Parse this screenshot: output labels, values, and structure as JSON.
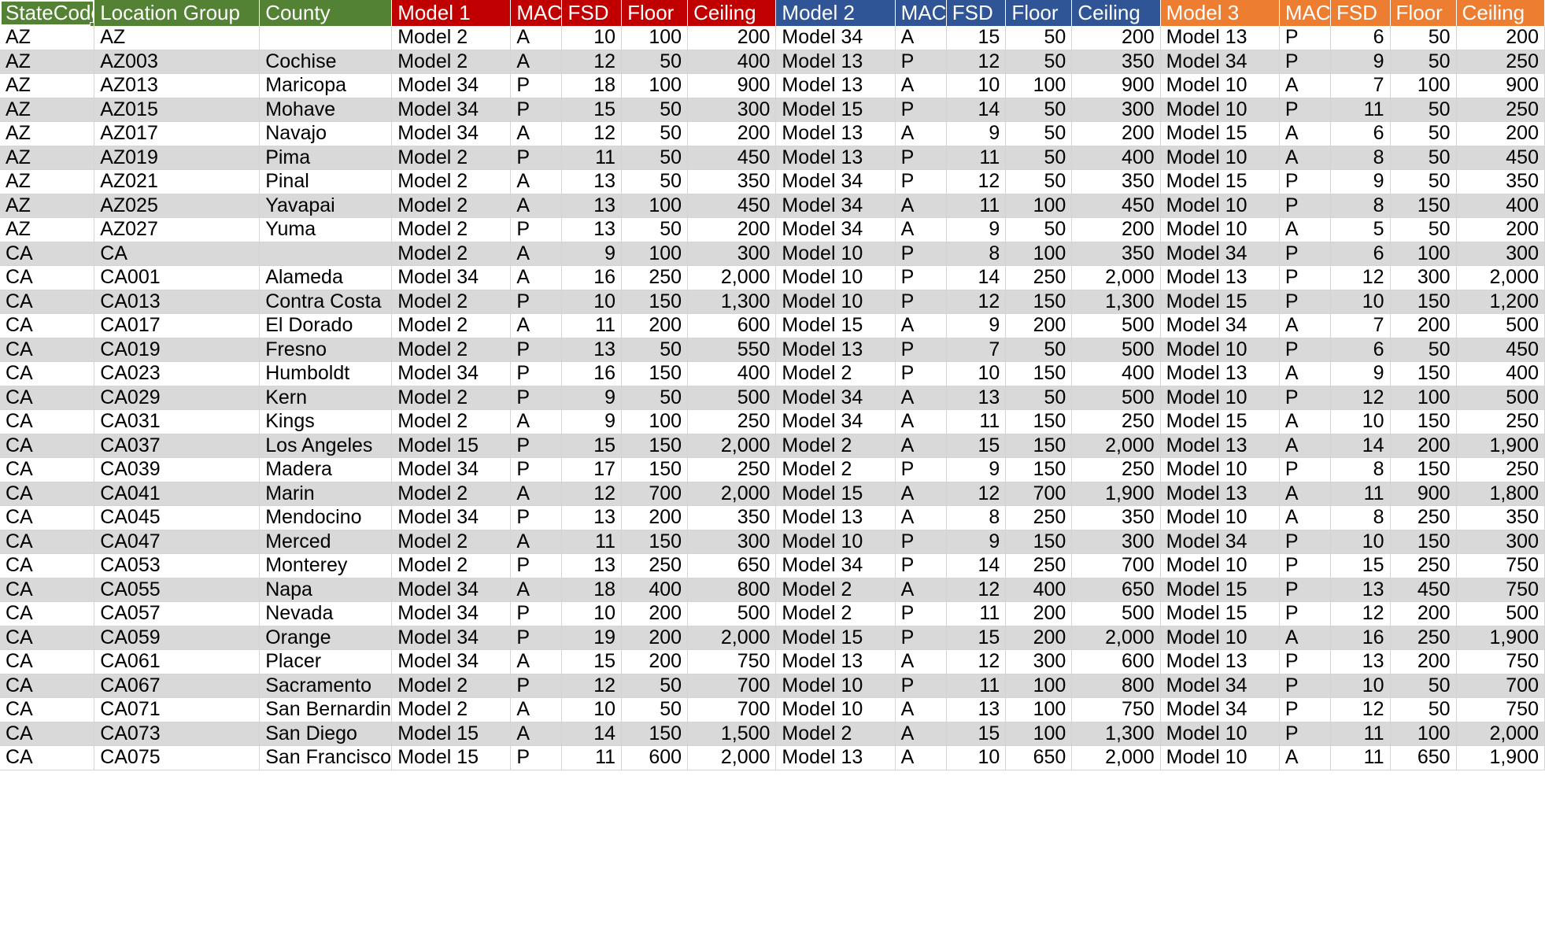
{
  "header": {
    "groups": [
      {
        "name": "key-group",
        "color": "#548235",
        "columns": [
          "StateCode",
          "Location Group",
          "County"
        ]
      },
      {
        "name": "model-1-group",
        "color": "#c00000",
        "columns": [
          "Model 1",
          "MAC",
          "FSD",
          "Floor",
          "Ceiling"
        ]
      },
      {
        "name": "model-2-group",
        "color": "#2f5597",
        "columns": [
          "Model 2",
          "MAC",
          "FSD",
          "Floor",
          "Ceiling"
        ]
      },
      {
        "name": "model-3-group",
        "color": "#ed7d31",
        "columns": [
          "Model 3",
          "MAC",
          "FSD",
          "Floor",
          "Ceiling"
        ]
      }
    ],
    "selected_cell": "StateCode"
  },
  "columns": [
    "StateCode",
    "Location Group",
    "County",
    "Model 1",
    "MAC",
    "FSD",
    "Floor",
    "Ceiling",
    "Model 2",
    "MAC",
    "FSD",
    "Floor",
    "Ceiling",
    "Model 3",
    "MAC",
    "FSD",
    "Floor",
    "Ceiling"
  ],
  "rows": [
    [
      "AZ",
      "AZ",
      "",
      "Model 2",
      "A",
      "10",
      "100",
      "200",
      "Model 34",
      "A",
      "15",
      "50",
      "200",
      "Model 13",
      "P",
      "6",
      "50",
      "200"
    ],
    [
      "AZ",
      "AZ003",
      "Cochise",
      "Model 2",
      "A",
      "12",
      "50",
      "400",
      "Model 13",
      "P",
      "12",
      "50",
      "350",
      "Model 34",
      "P",
      "9",
      "50",
      "250"
    ],
    [
      "AZ",
      "AZ013",
      "Maricopa",
      "Model 34",
      "P",
      "18",
      "100",
      "900",
      "Model 13",
      "A",
      "10",
      "100",
      "900",
      "Model 10",
      "A",
      "7",
      "100",
      "900"
    ],
    [
      "AZ",
      "AZ015",
      "Mohave",
      "Model 34",
      "P",
      "15",
      "50",
      "300",
      "Model 15",
      "P",
      "14",
      "50",
      "300",
      "Model 10",
      "P",
      "11",
      "50",
      "250"
    ],
    [
      "AZ",
      "AZ017",
      "Navajo",
      "Model 34",
      "A",
      "12",
      "50",
      "200",
      "Model 13",
      "A",
      "9",
      "50",
      "200",
      "Model 15",
      "A",
      "6",
      "50",
      "200"
    ],
    [
      "AZ",
      "AZ019",
      "Pima",
      "Model 2",
      "P",
      "11",
      "50",
      "450",
      "Model 13",
      "P",
      "11",
      "50",
      "400",
      "Model 10",
      "A",
      "8",
      "50",
      "450"
    ],
    [
      "AZ",
      "AZ021",
      "Pinal",
      "Model 2",
      "A",
      "13",
      "50",
      "350",
      "Model 34",
      "P",
      "12",
      "50",
      "350",
      "Model 15",
      "P",
      "9",
      "50",
      "350"
    ],
    [
      "AZ",
      "AZ025",
      "Yavapai",
      "Model 2",
      "A",
      "13",
      "100",
      "450",
      "Model 34",
      "A",
      "11",
      "100",
      "450",
      "Model 10",
      "P",
      "8",
      "150",
      "400"
    ],
    [
      "AZ",
      "AZ027",
      "Yuma",
      "Model 2",
      "P",
      "13",
      "50",
      "200",
      "Model 34",
      "A",
      "9",
      "50",
      "200",
      "Model 10",
      "A",
      "5",
      "50",
      "200"
    ],
    [
      "CA",
      "CA",
      "",
      "Model 2",
      "A",
      "9",
      "100",
      "300",
      "Model 10",
      "P",
      "8",
      "100",
      "350",
      "Model 34",
      "P",
      "6",
      "100",
      "300"
    ],
    [
      "CA",
      "CA001",
      "Alameda",
      "Model 34",
      "A",
      "16",
      "250",
      "2,000",
      "Model 10",
      "P",
      "14",
      "250",
      "2,000",
      "Model 13",
      "P",
      "12",
      "300",
      "2,000"
    ],
    [
      "CA",
      "CA013",
      "Contra Costa",
      "Model 2",
      "P",
      "10",
      "150",
      "1,300",
      "Model 10",
      "P",
      "12",
      "150",
      "1,300",
      "Model 15",
      "P",
      "10",
      "150",
      "1,200"
    ],
    [
      "CA",
      "CA017",
      "El Dorado",
      "Model 2",
      "A",
      "11",
      "200",
      "600",
      "Model 15",
      "A",
      "9",
      "200",
      "500",
      "Model 34",
      "A",
      "7",
      "200",
      "500"
    ],
    [
      "CA",
      "CA019",
      "Fresno",
      "Model 2",
      "P",
      "13",
      "50",
      "550",
      "Model 13",
      "P",
      "7",
      "50",
      "500",
      "Model 10",
      "P",
      "6",
      "50",
      "450"
    ],
    [
      "CA",
      "CA023",
      "Humboldt",
      "Model 34",
      "P",
      "16",
      "150",
      "400",
      "Model 2",
      "P",
      "10",
      "150",
      "400",
      "Model 13",
      "A",
      "9",
      "150",
      "400"
    ],
    [
      "CA",
      "CA029",
      "Kern",
      "Model 2",
      "P",
      "9",
      "50",
      "500",
      "Model 34",
      "A",
      "13",
      "50",
      "500",
      "Model 10",
      "P",
      "12",
      "100",
      "500"
    ],
    [
      "CA",
      "CA031",
      "Kings",
      "Model 2",
      "A",
      "9",
      "100",
      "250",
      "Model 34",
      "A",
      "11",
      "150",
      "250",
      "Model 15",
      "A",
      "10",
      "150",
      "250"
    ],
    [
      "CA",
      "CA037",
      "Los Angeles",
      "Model 15",
      "P",
      "15",
      "150",
      "2,000",
      "Model 2",
      "A",
      "15",
      "150",
      "2,000",
      "Model 13",
      "A",
      "14",
      "200",
      "1,900"
    ],
    [
      "CA",
      "CA039",
      "Madera",
      "Model 34",
      "P",
      "17",
      "150",
      "250",
      "Model 2",
      "P",
      "9",
      "150",
      "250",
      "Model 10",
      "P",
      "8",
      "150",
      "250"
    ],
    [
      "CA",
      "CA041",
      "Marin",
      "Model 2",
      "A",
      "12",
      "700",
      "2,000",
      "Model 15",
      "A",
      "12",
      "700",
      "1,900",
      "Model 13",
      "A",
      "11",
      "900",
      "1,800"
    ],
    [
      "CA",
      "CA045",
      "Mendocino",
      "Model 34",
      "P",
      "13",
      "200",
      "350",
      "Model 13",
      "A",
      "8",
      "250",
      "350",
      "Model 10",
      "A",
      "8",
      "250",
      "350"
    ],
    [
      "CA",
      "CA047",
      "Merced",
      "Model 2",
      "A",
      "11",
      "150",
      "300",
      "Model 10",
      "P",
      "9",
      "150",
      "300",
      "Model 34",
      "P",
      "10",
      "150",
      "300"
    ],
    [
      "CA",
      "CA053",
      "Monterey",
      "Model 2",
      "P",
      "13",
      "250",
      "650",
      "Model 34",
      "P",
      "14",
      "250",
      "700",
      "Model 10",
      "P",
      "15",
      "250",
      "750"
    ],
    [
      "CA",
      "CA055",
      "Napa",
      "Model 34",
      "A",
      "18",
      "400",
      "800",
      "Model 2",
      "A",
      "12",
      "400",
      "650",
      "Model 15",
      "P",
      "13",
      "450",
      "750"
    ],
    [
      "CA",
      "CA057",
      "Nevada",
      "Model 34",
      "P",
      "10",
      "200",
      "500",
      "Model 2",
      "P",
      "11",
      "200",
      "500",
      "Model 15",
      "P",
      "12",
      "200",
      "500"
    ],
    [
      "CA",
      "CA059",
      "Orange",
      "Model 34",
      "P",
      "19",
      "200",
      "2,000",
      "Model 15",
      "P",
      "15",
      "200",
      "2,000",
      "Model 10",
      "A",
      "16",
      "250",
      "1,900"
    ],
    [
      "CA",
      "CA061",
      "Placer",
      "Model 34",
      "A",
      "15",
      "200",
      "750",
      "Model 13",
      "A",
      "12",
      "300",
      "600",
      "Model 13",
      "P",
      "13",
      "200",
      "750"
    ],
    [
      "CA",
      "CA067",
      "Sacramento",
      "Model 2",
      "P",
      "12",
      "50",
      "700",
      "Model 10",
      "P",
      "11",
      "100",
      "800",
      "Model 34",
      "P",
      "10",
      "50",
      "700"
    ],
    [
      "CA",
      "CA071",
      "San Bernardino",
      "Model 2",
      "A",
      "10",
      "50",
      "700",
      "Model 10",
      "A",
      "13",
      "100",
      "750",
      "Model 34",
      "P",
      "12",
      "50",
      "750"
    ],
    [
      "CA",
      "CA073",
      "San Diego",
      "Model 15",
      "A",
      "14",
      "150",
      "1,500",
      "Model 2",
      "A",
      "15",
      "100",
      "1,300",
      "Model 10",
      "P",
      "11",
      "100",
      "2,000"
    ],
    [
      "CA",
      "CA075",
      "San Francisco",
      "Model 15",
      "P",
      "11",
      "600",
      "2,000",
      "Model 13",
      "A",
      "10",
      "650",
      "2,000",
      "Model 10",
      "A",
      "11",
      "650",
      "1,900"
    ]
  ]
}
